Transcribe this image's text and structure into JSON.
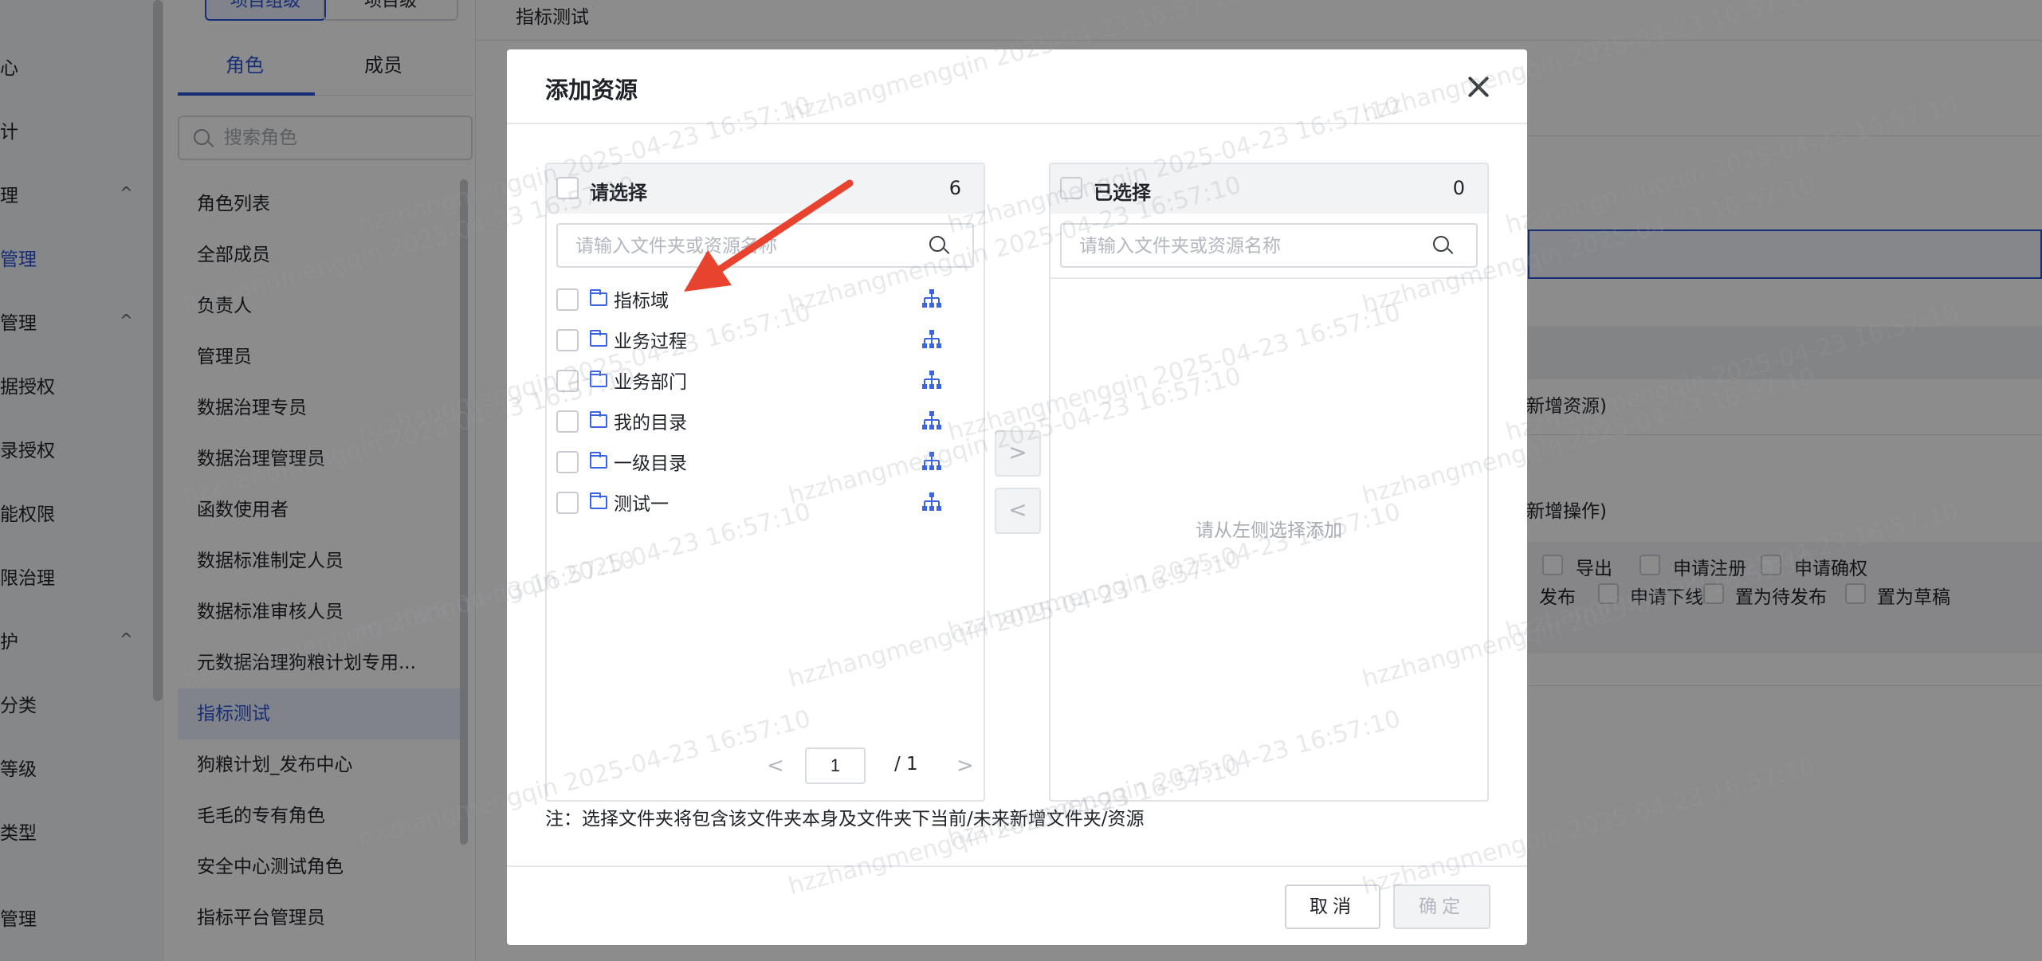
{
  "nav": {
    "items": [
      {
        "label": "心",
        "active": false,
        "caret": false
      },
      {
        "label": "计",
        "active": false,
        "caret": false
      },
      {
        "label": "理",
        "active": false,
        "caret": true
      },
      {
        "label": "管理",
        "active": true,
        "caret": false
      },
      {
        "label": "管理",
        "active": false,
        "caret": true
      },
      {
        "label": "据授权",
        "active": false,
        "caret": false
      },
      {
        "label": "录授权",
        "active": false,
        "caret": false
      },
      {
        "label": "能权限",
        "active": false,
        "caret": false
      },
      {
        "label": "限治理",
        "active": false,
        "caret": false
      },
      {
        "label": "护",
        "active": false,
        "caret": true
      },
      {
        "label": "分类",
        "active": false,
        "caret": false
      },
      {
        "label": "等级",
        "active": false,
        "caret": false
      },
      {
        "label": "类型",
        "active": false,
        "caret": false
      },
      {
        "label": "管理",
        "active": false,
        "caret": false
      }
    ],
    "caret_glyph": "^"
  },
  "role_panel": {
    "top_tabs": [
      "项目组级",
      "项目级"
    ],
    "tabs": [
      "角色",
      "成员"
    ],
    "search_placeholder": "搜索角色",
    "roles": [
      "角色列表",
      "全部成员",
      "负责人",
      "管理员",
      "数据治理专员",
      "数据治理管理员",
      "函数使用者",
      "数据标准制定人员",
      "数据标准审核人员",
      "元数据治理狗粮计划专用...",
      "指标测试",
      "狗粮计划_发布中心",
      "毛毛的专有角色",
      "安全中心测试角色",
      "指标平台管理员"
    ],
    "active_role": "指标测试"
  },
  "main": {
    "breadcrumb": "指标测试",
    "resource_hint": "新增资源)",
    "operation_hint": "新增操作)",
    "perm_row1": [
      "导出",
      "申请注册",
      "申请确权"
    ],
    "perm_row2": [
      "发布",
      "申请下线",
      "置为待发布",
      "置为草稿"
    ]
  },
  "modal": {
    "title": "添加资源",
    "left": {
      "title": "请选择",
      "count": "6",
      "search_placeholder": "请输入文件夹或资源名称",
      "items": [
        "指标域",
        "业务过程",
        "业务部门",
        "我的目录",
        "一级目录",
        "测试一"
      ],
      "page": "1",
      "total_pages": "/ 1",
      "prev_glyph": "<",
      "next_glyph": ">"
    },
    "transfer": {
      "right_glyph": ">",
      "left_glyph": "<"
    },
    "right": {
      "title": "已选择",
      "count": "0",
      "search_placeholder": "请输入文件夹或资源名称",
      "empty_text": "请从左侧选择添加"
    },
    "note": "注：选择文件夹将包含该文件夹本身及文件夹下当前/未来新增文件夹/资源",
    "cancel_label": "取消",
    "ok_label": "确定"
  },
  "watermark": "hzzhangmengqin 2025-04-23 16:57:10",
  "colors": {
    "accent": "#2b54d9",
    "arrow": "#e8432f",
    "folder_icon": "#3a64e0"
  }
}
